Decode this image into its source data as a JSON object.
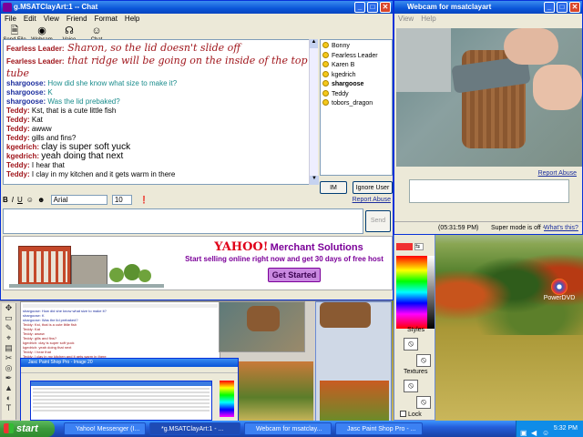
{
  "colors": {
    "accent": "#0a55d8",
    "yahoo_purple": "#7b0099",
    "yahoo_red": "#e0001a"
  },
  "chat": {
    "title": "g.MSATClayArt:1 -- Chat",
    "menu": [
      "File",
      "Edit",
      "View",
      "Friend",
      "Format",
      "Help"
    ],
    "toolbar": [
      "Send File",
      "Webcam",
      "Voice",
      "Chat"
    ],
    "messages": [
      {
        "name": "Fearless Leader:",
        "text": "Sharon, so the lid doesn't slide off",
        "nc": "#a0161c",
        "tc": "#a0161c",
        "fancy": true
      },
      {
        "name": "Fearless Leader:",
        "text": "that ridge will be going on the inside of the top tube",
        "nc": "#a0161c",
        "tc": "#a0161c",
        "fancy": true
      },
      {
        "name": "shargoose:",
        "text": "How did she know what size to make it?",
        "nc": "#1d2f9e",
        "tc": "#1a8c8c"
      },
      {
        "name": "shargoose:",
        "text": "K",
        "nc": "#1d2f9e",
        "tc": "#1a8c8c"
      },
      {
        "name": "shargoose:",
        "text": "Was the lid prebaked?",
        "nc": "#1d2f9e",
        "tc": "#1a8c8c"
      },
      {
        "name": "Teddy:",
        "text": "Kst, that is a cute little fish",
        "nc": "#a0161c",
        "tc": "#000"
      },
      {
        "name": "Teddy:",
        "text": "Kat",
        "nc": "#a0161c",
        "tc": "#000"
      },
      {
        "name": "Teddy:",
        "text": "awww",
        "nc": "#a0161c",
        "tc": "#000"
      },
      {
        "name": "Teddy:",
        "text": "gills and fins?",
        "nc": "#a0161c",
        "tc": "#000"
      },
      {
        "name": "kgedrich:",
        "text": "clay is super soft yuck",
        "nc": "#a0161c",
        "tc": "#000",
        "big": true
      },
      {
        "name": "kgedrich:",
        "text": "yeah doing that next",
        "nc": "#a0161c",
        "tc": "#000",
        "big": true
      },
      {
        "name": "Teddy:",
        "text": "I hear that",
        "nc": "#a0161c",
        "tc": "#000"
      },
      {
        "name": "Teddy:",
        "text": "I clay in my kitchen and it gets warm in there",
        "nc": "#a0161c",
        "tc": "#000"
      }
    ],
    "users": [
      "Bonny",
      "Fearless Leader",
      "Karen B",
      "kgedrich",
      "shargoose",
      "Teddy",
      "tobors_dragon"
    ],
    "im_button": "IM",
    "ignore_button": "Ignore User",
    "report_abuse": "Report Abuse",
    "font": "Arial",
    "font_size": "10",
    "send": "Send",
    "ad": {
      "logo": "YAHOO!",
      "brand": "Merchant Solutions",
      "line": "Start selling online right now and get 30 days of free host",
      "cta": "Get Started"
    }
  },
  "webcam": {
    "title": "Webcam for msatclayart",
    "menu": [
      "View",
      "Help"
    ],
    "report_abuse": "Report Abuse",
    "time": "(05:31:59 PM)",
    "super_mode": "Super mode is off -",
    "whats_this": "What's this?"
  },
  "paint": {
    "styles": "Styles",
    "textures": "Textures",
    "lock": "Lock"
  },
  "desktop": {
    "icon_label": "PowerDVD"
  },
  "taskbar": {
    "start": "start",
    "items": [
      "Yahoo! Messenger (I...",
      "*g.MSATClayArt:1 - ...",
      "Webcam for msatclay...",
      "Jasc Paint Shop Pro - ..."
    ],
    "clock": "5:32 PM"
  }
}
